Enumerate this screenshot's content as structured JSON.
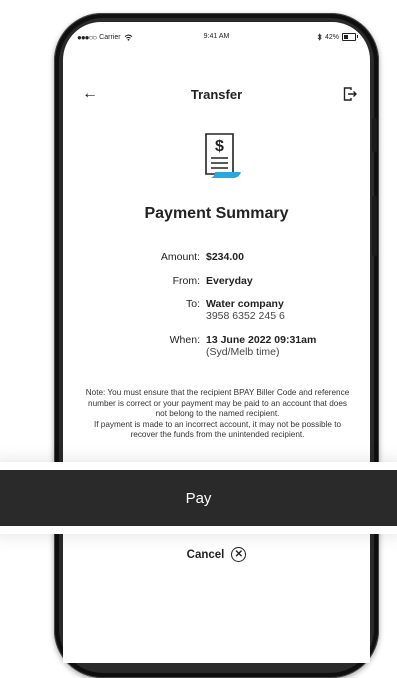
{
  "status_bar": {
    "carrier": "Carrier",
    "time": "9:41 AM",
    "battery": "42%",
    "battery_level": 0.42
  },
  "header": {
    "title": "Transfer",
    "back_icon": "arrow-left-icon",
    "exit_icon": "logout-icon"
  },
  "summary": {
    "icon": "receipt-icon",
    "title": "Payment Summary",
    "amount_label": "Amount:",
    "amount_value": "$234.00",
    "from_label": "From:",
    "from_value": "Everyday",
    "to_label": "To:",
    "to_value": "Water company",
    "to_sub": "3958 6352 245 6",
    "when_label": "When:",
    "when_value": "13 June 2022 09:31am",
    "when_sub": "(Syd/Melb time)"
  },
  "note": {
    "line1": "Note: You must ensure that the recipient BPAY Biller Code and reference number is correct or your payment may be paid to an account that does not belong to the named recipient.",
    "line2": "If payment is made to an incorrect account, it may not be possible to recover the funds from the unintended recipient."
  },
  "actions": {
    "pay_label": "Pay",
    "cancel_label": "Cancel",
    "cancel_icon": "close-circle-icon"
  },
  "colors": {
    "button_bg": "#2a2a2a",
    "accent_blue": "#29a8e0",
    "text": "#222222"
  }
}
